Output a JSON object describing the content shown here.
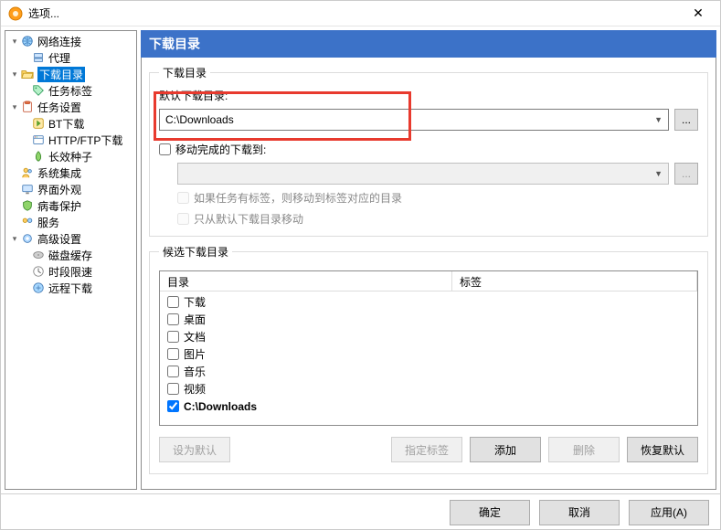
{
  "window": {
    "title": "选项..."
  },
  "sidebar": {
    "items": [
      {
        "label": "网络连接"
      },
      {
        "label": "代理"
      },
      {
        "label": "下载目录"
      },
      {
        "label": "任务标签"
      },
      {
        "label": "任务设置"
      },
      {
        "label": "BT下载"
      },
      {
        "label": "HTTP/FTP下载"
      },
      {
        "label": "长效种子"
      },
      {
        "label": "系统集成"
      },
      {
        "label": "界面外观"
      },
      {
        "label": "病毒保护"
      },
      {
        "label": "服务"
      },
      {
        "label": "高级设置"
      },
      {
        "label": "磁盘缓存"
      },
      {
        "label": "时段限速"
      },
      {
        "label": "远程下载"
      }
    ]
  },
  "panel": {
    "title": "下载目录",
    "fieldset1": {
      "legend": "下载目录",
      "default_label": "默认下载目录:",
      "default_path": "C:\\Downloads",
      "move_done_label": "移动完成的下载到:",
      "move_done_path": "",
      "if_tag_label": "如果任务有标签，则移动到标签对应的目录",
      "only_default_label": "只从默认下载目录移动"
    },
    "fieldset2": {
      "legend": "候选下载目录",
      "col1": "目录",
      "col2": "标签",
      "rows": [
        {
          "label": "下载",
          "checked": false
        },
        {
          "label": "桌面",
          "checked": false
        },
        {
          "label": "文档",
          "checked": false
        },
        {
          "label": "图片",
          "checked": false
        },
        {
          "label": "音乐",
          "checked": false
        },
        {
          "label": "视频",
          "checked": false
        },
        {
          "label": "C:\\Downloads",
          "checked": true
        }
      ],
      "buttons": {
        "set_default": "设为默认",
        "set_tag": "指定标签",
        "add": "添加",
        "delete": "删除",
        "reset": "恢复默认"
      }
    }
  },
  "footer": {
    "ok": "确定",
    "cancel": "取消",
    "apply": "应用(A)"
  }
}
